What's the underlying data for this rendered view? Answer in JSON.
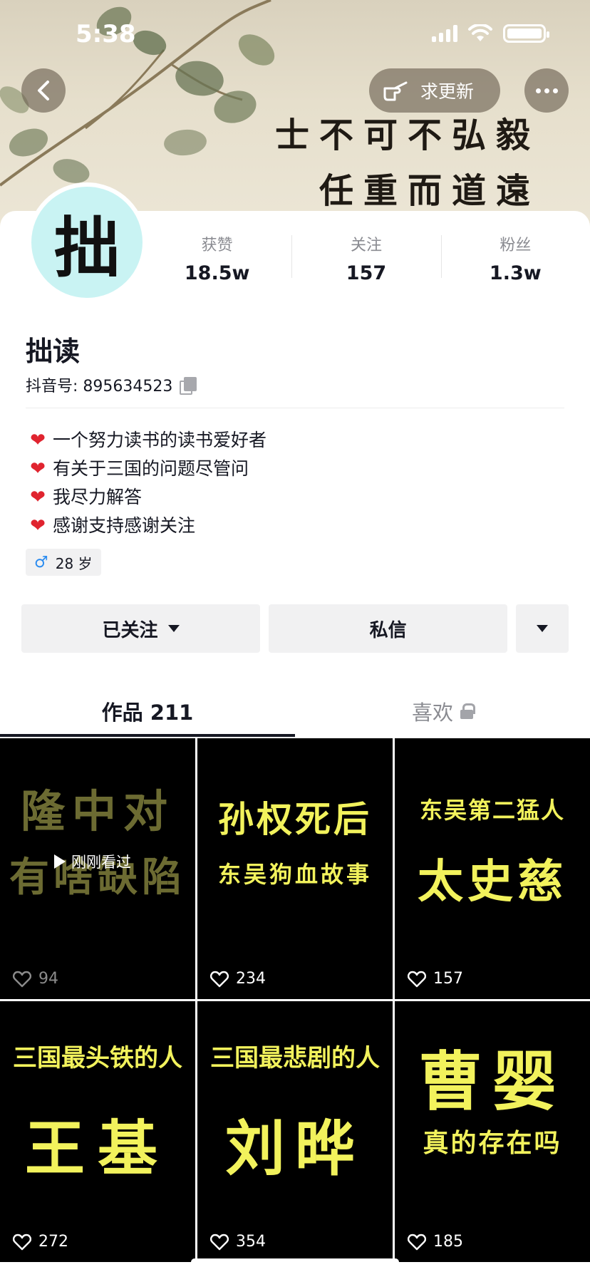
{
  "status_bar": {
    "time": "5:38"
  },
  "banner": {
    "poem_line1": "士不可不弘毅",
    "poem_line2": "任重而道遠",
    "urge_update_label": "求更新"
  },
  "profile": {
    "avatar_char": "拙",
    "name": "拙读",
    "douyin_id": "抖音号: 895634523",
    "stats": [
      {
        "label": "获赞",
        "value": "18.5w"
      },
      {
        "label": "关注",
        "value": "157"
      },
      {
        "label": "粉丝",
        "value": "1.3w"
      }
    ],
    "bio_lines": [
      "一个努力读书的读书爱好者",
      "有关于三国的问题尽管问",
      "我尽力解答",
      "感谢支持感谢关注"
    ],
    "age_tag": "28 岁"
  },
  "actions": {
    "followed_label": "已关注",
    "message_label": "私信"
  },
  "tabs": {
    "works_label": "作品 211",
    "likes_label": "喜欢"
  },
  "videos": [
    {
      "line1": "隆中对",
      "line2": "有啥缺陷",
      "likes": "94",
      "watched_label": "刚刚看过"
    },
    {
      "line1": "孙权死后",
      "line2": "东吴狗血故事",
      "likes": "234"
    },
    {
      "line1": "东吴第二猛人",
      "line2": "太史慈",
      "likes": "157"
    },
    {
      "line1": "三国最头铁的人",
      "line2": "王基",
      "likes": "272"
    },
    {
      "line1": "三国最悲剧的人",
      "line2": "刘晔",
      "likes": "354"
    },
    {
      "line1": "曹婴",
      "line2": "真的存在吗",
      "likes": "185"
    }
  ],
  "colors": {
    "caption_yellow": "#f2f25c",
    "text_primary": "#161823",
    "text_secondary": "#8a8b91",
    "heart_red": "#e0242f",
    "avatar_bg": "#c9f3f3"
  }
}
